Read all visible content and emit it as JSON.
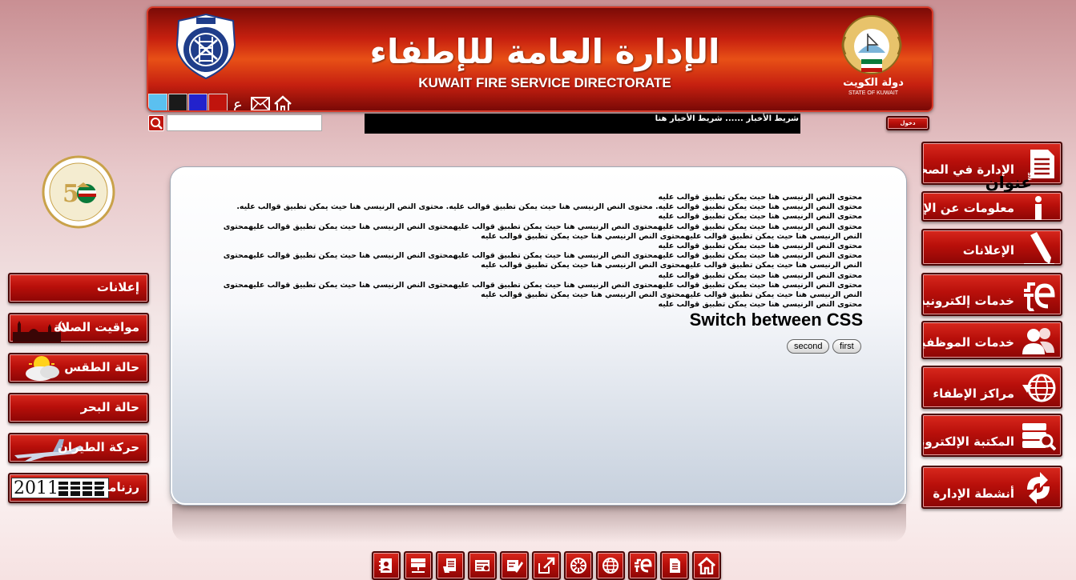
{
  "header": {
    "title_ar": "الإدارة العامة للإطفاء",
    "title_en": "KUWAIT FIRE SERVICE DIRECTORATE",
    "state_ar": "دولة الكويت",
    "state_en": "STATE OF KUWAIT",
    "lang_toggle": "ع",
    "theme_swatches": [
      "#5bc0f0",
      "#1a1a1a",
      "#2222cc",
      "#c0140d"
    ],
    "icons": [
      "home-icon",
      "mail-icon"
    ]
  },
  "search": {
    "placeholder": "",
    "button_icon": "search-icon"
  },
  "news_ticker": {
    "text": "شريط الأخبار ...... شريط الأخبار  هنا"
  },
  "login": {
    "label": "دخول"
  },
  "left_nav": [
    {
      "label": "إعلانات",
      "icon": "announcement-icon"
    },
    {
      "label": "مواقيت الصلاة",
      "icon": "mosque-icon"
    },
    {
      "label": "حالة الطقس",
      "icon": "weather-icon"
    },
    {
      "label": "حالة البحر",
      "icon": "sea-icon"
    },
    {
      "label": "حركة الطيران",
      "icon": "airplane-icon"
    },
    {
      "label": "رزنامة",
      "icon": "calendar-icon",
      "year": "2011"
    }
  ],
  "right_nav": [
    {
      "label": "الإدارة في الصحف",
      "icon": "newspaper-icon"
    },
    {
      "label": "معلومات عن الإدارة",
      "icon": "info-icon"
    },
    {
      "label": "الإعلانات",
      "icon": "pencil-icon"
    },
    {
      "label": "خدمات إلكترونية",
      "icon": "e-services-icon"
    },
    {
      "label": "خدمات الموظفين",
      "icon": "users-icon"
    },
    {
      "label": "مراكز الإطفاء",
      "icon": "globe-icon"
    },
    {
      "label": "المكتبة الإلكترونية",
      "icon": "library-icon"
    },
    {
      "label": "أنشطة الإدارة",
      "icon": "refresh-icon"
    }
  ],
  "content": {
    "title": "عنوان",
    "paragraphs": [
      "محتوى النص الرنيسي هنا حيث يمكن تطبيق قوالب عليه",
      "محتوى النص الرنيسي هنا حيث يمكن تطبيق قوالب عليه. محتوى النص الرنيسي هنا حيث يمكن تطبيق قوالب عليه. محتوى النص الرنيسي هنا حيث يمكن تطبيق قوالب عليه.",
      "محتوى النص الرنيسي هنا حيث يمكن تطبيق قوالب عليه",
      "محتوى النص الرنيسي هنا حيث يمكن تطبيق قوالب عليهمحتوى النص الرنيسي هنا حيث يمكن تطبيق قوالب عليهمحتوى النص الرنيسي هنا حيث يمكن تطبيق قوالب عليهمحتوى النص الرنيسي هنا حيث يمكن تطبيق قوالب عليهمحتوى النص الرنيسي هنا حيث يمكن تطبيق قوالب عليه",
      "محتوى النص الرنيسي هنا حيث يمكن تطبيق قوالب عليه",
      "محتوى النص الرنيسي هنا حيث يمكن تطبيق قوالب عليهمحتوى النص الرنيسي هنا حيث يمكن تطبيق قوالب عليهمحتوى النص الرنيسي هنا حيث يمكن تطبيق قوالب عليهمحتوى النص الرنيسي هنا حيث يمكن تطبيق قوالب عليهمحتوى النص الرنيسي هنا حيث يمكن تطبيق قوالب عليه",
      "محتوى النص الرنيسي هنا حيث يمكن تطبيق قوالب عليه",
      "محتوى النص الرنيسي هنا حيث يمكن تطبيق قوالب عليهمحتوى النص الرنيسي هنا حيث يمكن تطبيق قوالب عليهمحتوى النص الرنيسي هنا حيث يمكن تطبيق قوالب عليهمحتوى النص الرنيسي هنا حيث يمكن تطبيق قوالب عليهمحتوى النص الرنيسي هنا حيث يمكن تطبيق قوالب عليه",
      "محتوى النص الرنيسي هنا حيث يمكن تطبيق قوالب عليه"
    ],
    "switch_title": "Switch between CSS",
    "btn_first": "first",
    "btn_second": "second"
  },
  "footer": {
    "icons": [
      "contact-icon",
      "server-icon",
      "document-hand-icon",
      "form-icon",
      "pen-icon",
      "external-link-icon",
      "fire-logo-icon",
      "globe-icon",
      "e-services-icon",
      "document-icon",
      "home-icon"
    ]
  },
  "colors": {
    "brand_red": "#c0140d",
    "background_top": "#c98f93",
    "ticker_bg": "#000000"
  }
}
